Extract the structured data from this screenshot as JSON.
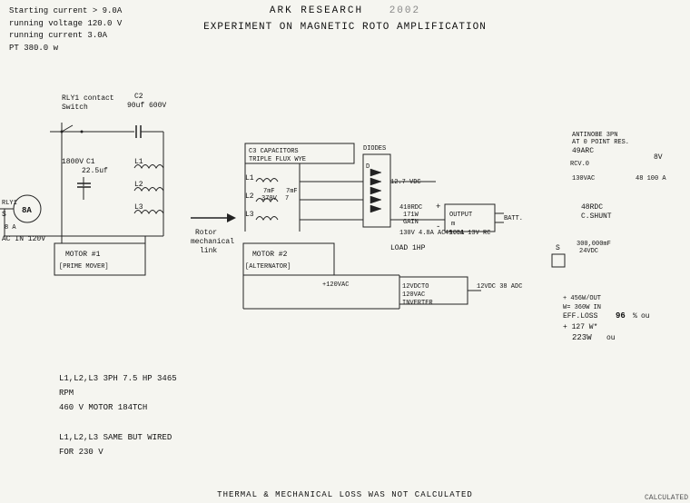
{
  "header": {
    "title": "ARK RESEARCH",
    "year": "2002",
    "subtitle": "EXPERIMENT ON MAGNETIC ROTO AMPLIFICATION"
  },
  "specs_top_left": {
    "line1": "Starting current > 9.0A",
    "line2": "running voltage 120.0 V",
    "line3": "running current    3.0A",
    "line4": "PT 380.0  w"
  },
  "specs_bottom_left": {
    "line1": "L1,L2,L3  3PH 7.5 HP 3465",
    "line2": "RPM",
    "line3": "          460 V MOTOR 184TCH",
    "line4": "",
    "line5": "L1,L2,L3  SAME BUT WIRED",
    "line6": "          FOR 230 V"
  },
  "bottom_notice": "THERMAL & MECHANICAL LOSS WAS NOT CALCULATED",
  "calc_label": "CALCULATED"
}
